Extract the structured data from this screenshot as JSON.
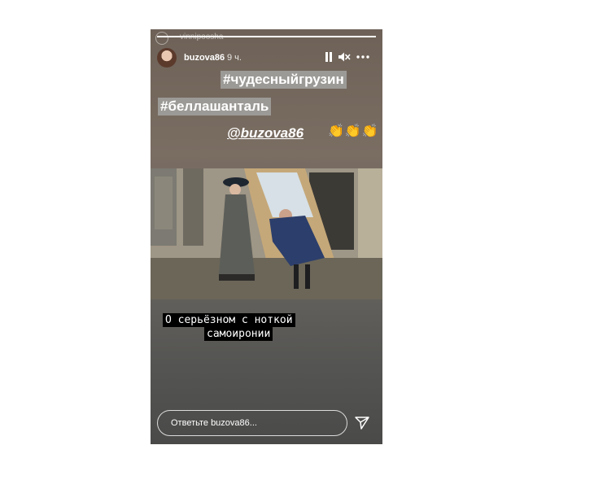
{
  "story": {
    "watermark": "vinnipoosha",
    "username": "buzova86",
    "time_ago": "9 ч.",
    "progress_fraction": 1.0
  },
  "controls": {
    "pause_icon": "pause-icon",
    "mute_icon": "speaker-muted-icon",
    "more_icon": "more-horizontal-icon"
  },
  "overlay": {
    "hashtag1": "#чудесныйгрузин",
    "hashtag2": "#беллашанталь",
    "mention": "@buzova86",
    "emoji": "👏👏👏"
  },
  "caption": {
    "line1": "О серьёзном с ноткой",
    "line2": "самоиронии"
  },
  "reply": {
    "placeholder": "Ответьте buzova86...",
    "send_icon": "paper-plane-icon"
  },
  "colors": {
    "tag_background": "#9c9a96",
    "emoji": "#f2c43b"
  }
}
